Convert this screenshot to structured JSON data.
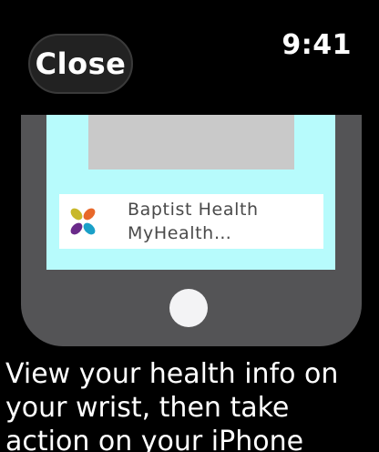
{
  "header": {
    "close_label": "Close",
    "time": "9:41"
  },
  "phone_illustration": {
    "notification": {
      "app_icon": "baptist-health-flower-icon",
      "title_line1": "Baptist Health",
      "title_line2": "MyHealth…"
    }
  },
  "caption": "View your health info on your wrist, then take action on your iPhone",
  "colors": {
    "background": "#000000",
    "close_button": "#222222",
    "phone_body": "#545456",
    "phone_screen": "#b7fbfc",
    "placeholder_block": "#c9c9c9",
    "home_button": "#f3f3f5"
  }
}
